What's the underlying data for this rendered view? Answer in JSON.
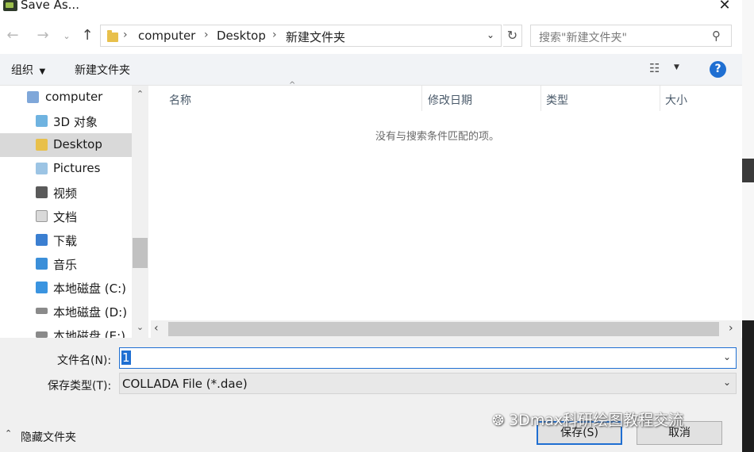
{
  "window": {
    "title": "Save As..."
  },
  "address": {
    "crumbs": [
      "computer",
      "Desktop",
      "新建文件夹"
    ]
  },
  "search": {
    "placeholder": "搜索\"新建文件夹\""
  },
  "toolbar": {
    "organize": "组织",
    "new_folder": "新建文件夹"
  },
  "sidebar": {
    "items": [
      {
        "label": "computer",
        "icon": "computer-icon"
      },
      {
        "label": "3D 对象",
        "icon": "3d-objects-icon"
      },
      {
        "label": "Desktop",
        "icon": "desktop-folder-icon",
        "selected": true
      },
      {
        "label": "Pictures",
        "icon": "pictures-folder-icon"
      },
      {
        "label": "视频",
        "icon": "videos-folder-icon"
      },
      {
        "label": "文档",
        "icon": "documents-folder-icon"
      },
      {
        "label": "下载",
        "icon": "downloads-folder-icon"
      },
      {
        "label": "音乐",
        "icon": "music-folder-icon"
      },
      {
        "label": "本地磁盘 (C:)",
        "icon": "windows-drive-icon"
      },
      {
        "label": "本地磁盘 (D:)",
        "icon": "drive-icon"
      },
      {
        "label": "本地磁盘 (E:)",
        "icon": "drive-icon"
      }
    ]
  },
  "columns": [
    "名称",
    "修改日期",
    "类型",
    "大小"
  ],
  "empty_message": "没有与搜索条件匹配的项。",
  "form": {
    "filename_label": "文件名(N):",
    "filename_value": "1",
    "filetype_label": "保存类型(T):",
    "filetype_value": "COLLADA File (*.dae)"
  },
  "footer": {
    "hide_folders": "隐藏文件夹",
    "save": "保存(S)",
    "cancel": "取消"
  },
  "watermark": "3Dmax科研绘图教程交流",
  "colors": {
    "accent": "#1f6fd2",
    "selection": "#d9d9d9",
    "folder": "#e8c04b"
  }
}
